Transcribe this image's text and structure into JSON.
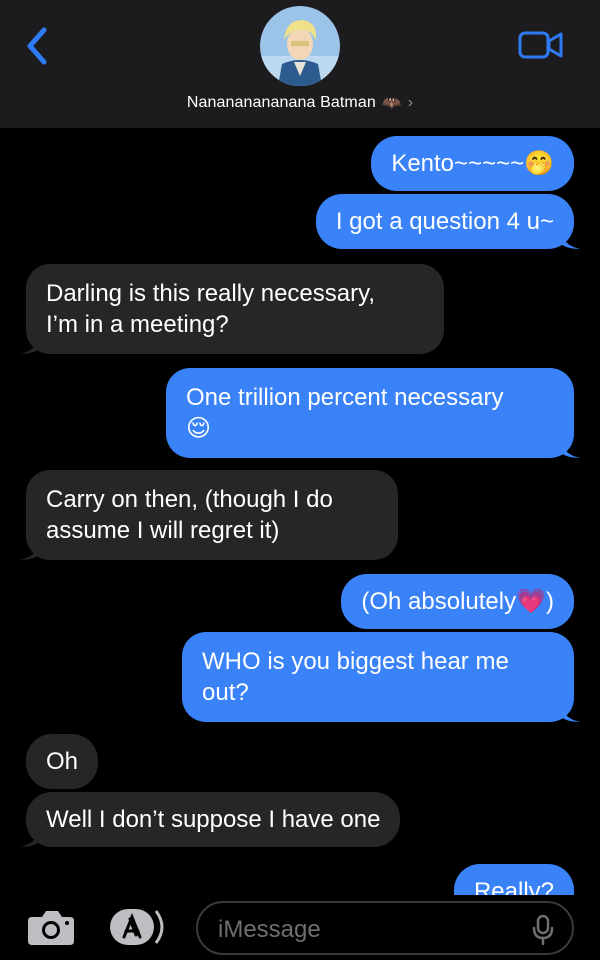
{
  "header": {
    "contact_name": "Nanananananana Batman",
    "contact_emoji": "🦇",
    "chevron": "›"
  },
  "messages": [
    {
      "from": "me",
      "text": "Kento~~~~~",
      "emoji": "🤭"
    },
    {
      "from": "me",
      "text": "I got a question 4 u~"
    },
    {
      "from": "them",
      "line1": "Darling is this really necessary,",
      "line2": "I’m in a meeting?"
    },
    {
      "from": "me",
      "line1": "One trillion percent necessary",
      "emoji": "😌"
    },
    {
      "from": "them",
      "line1": "Carry on then, (though I do",
      "line2": "assume I will regret it)"
    },
    {
      "from": "me",
      "text": "(Oh absolutely",
      "emoji": "💗",
      "end": ")"
    },
    {
      "from": "me",
      "line1": "WHO is you biggest hear me",
      "line2": "out?"
    },
    {
      "from": "them",
      "text": "Oh"
    },
    {
      "from": "them",
      "text": "Well I don’t suppose I have one"
    },
    {
      "from": "me",
      "text": "Really?"
    }
  ],
  "input": {
    "placeholder": "iMessage"
  },
  "colors": {
    "sent_bubble": "#3a82f7",
    "recv_bubble": "#262628",
    "accent": "#2f7bf6",
    "header_bg": "#1c1c1e"
  },
  "icons": {
    "back": "chevron-left-icon",
    "video": "video-camera-icon",
    "camera": "camera-icon",
    "apps": "app-store-icon",
    "mic": "microphone-icon"
  }
}
